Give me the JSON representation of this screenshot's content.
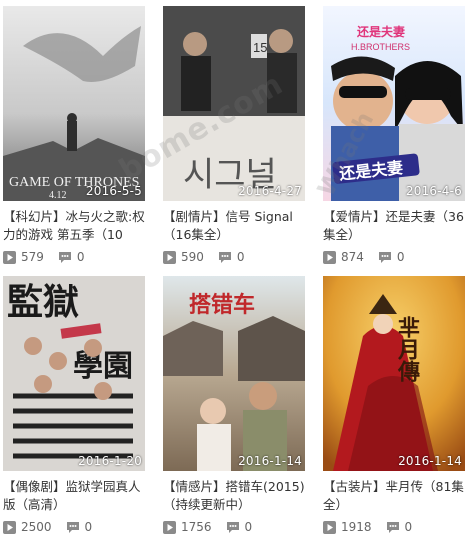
{
  "watermark": "bome.com",
  "watermark2": "Whach",
  "items": [
    {
      "tag": "【科幻片】",
      "title": "冰与火之歌:权力的游戏 第五季（10",
      "date": "2016-5-5",
      "plays": "579",
      "comments": "0",
      "poster_text": "GAME OF THRONES",
      "poster_sub": "4.12"
    },
    {
      "tag": "【剧情片】",
      "title": "信号 Signal（16集全）",
      "date": "2016-4-27",
      "plays": "590",
      "comments": "0",
      "poster_text": "시그널",
      "poster_sub": "15"
    },
    {
      "tag": "【爱情片】",
      "title": "还是夫妻（36集全）",
      "date": "2016-4-6",
      "plays": "874",
      "comments": "0",
      "poster_text": "还是夫妻",
      "poster_sub": "H.BROTHERS"
    },
    {
      "tag": "【偶像剧】",
      "title": "监狱学园真人版（高清）",
      "date": "2016-1-20",
      "plays": "2500",
      "comments": "0",
      "poster_text": "監獄",
      "poster_sub": "學園"
    },
    {
      "tag": "【情感片】",
      "title": "搭错车(2015)（持续更新中）",
      "date": "2016-1-14",
      "plays": "1756",
      "comments": "0",
      "poster_text": "搭错车",
      "poster_sub": ""
    },
    {
      "tag": "【古装片】",
      "title": "芈月传（81集全）",
      "date": "2016-1-14",
      "plays": "1918",
      "comments": "0",
      "poster_text": "芈月傳",
      "poster_sub": ""
    }
  ]
}
